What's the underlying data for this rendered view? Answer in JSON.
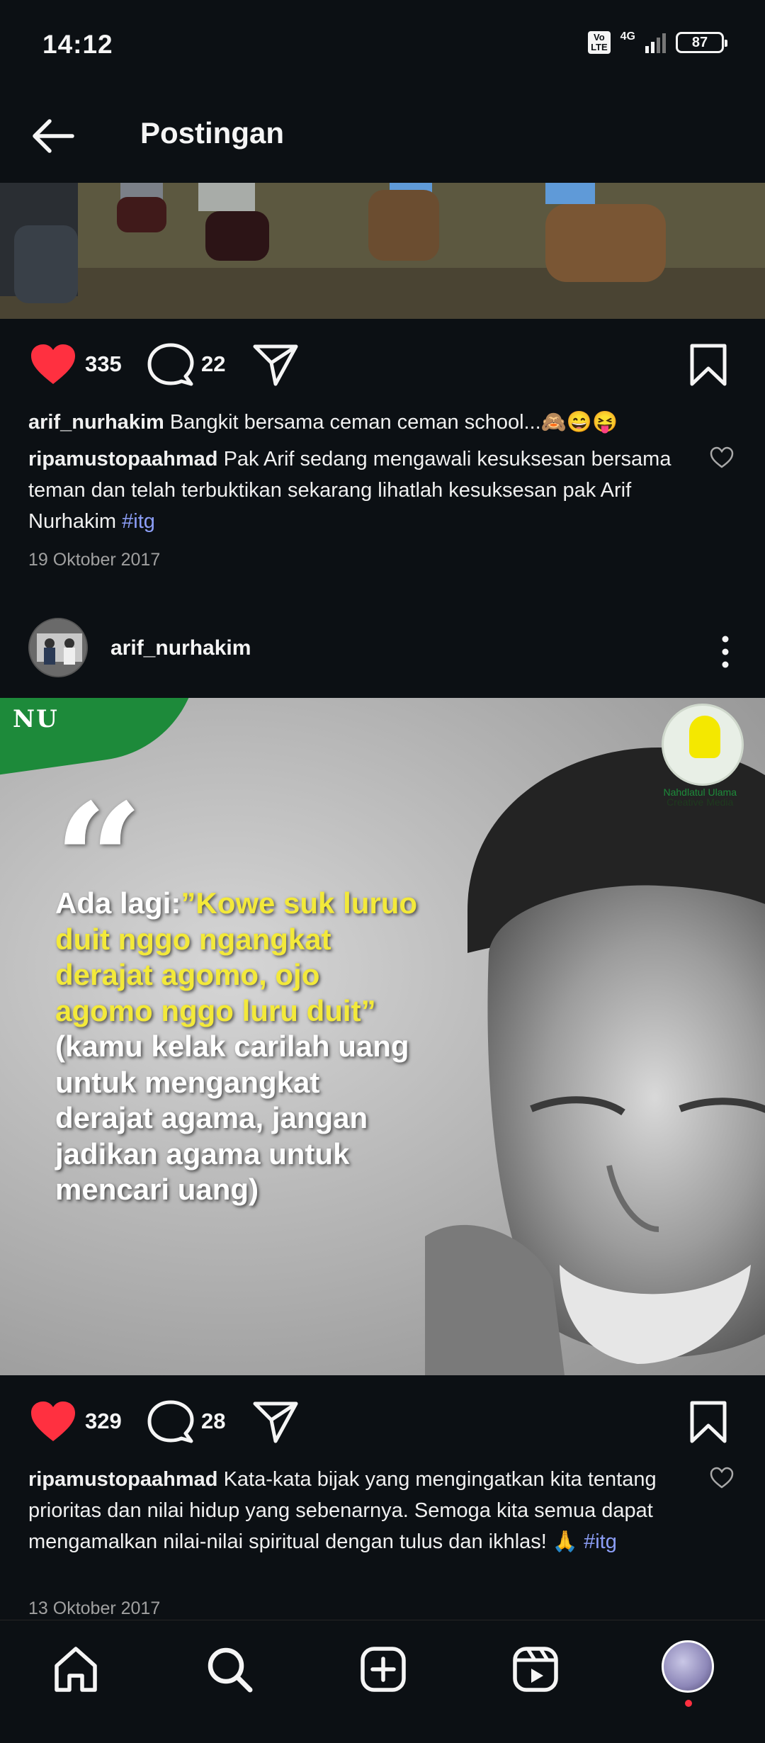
{
  "status_bar": {
    "time": "14:12",
    "volte": "Vo\nLTE",
    "network": "4G",
    "battery": "87"
  },
  "header": {
    "title": "Postingan"
  },
  "post1": {
    "likes": "335",
    "comments": "22",
    "caption_user": "arif_nurhakim",
    "caption_text": "Bangkit bersama ceman ceman school...🙈😄😝",
    "comment_user": "ripamustopaahmad",
    "comment_text": "Pak Arif sedang mengawali kesuksesan bersama teman dan telah terbuktikan sekarang lihatlah kesuksesan pak Arif Nurhakim ",
    "comment_tag": "#itg",
    "date": "19 Oktober 2017"
  },
  "post2": {
    "username": "arif_nurhakim",
    "image": {
      "logo_left": "NU",
      "logo_right_line1": "Nahdlatul Ulama",
      "logo_right_line2": "Creative Media",
      "quote_mark": "“",
      "quote_lead": "Ada lagi:",
      "quote_highlight": "”Kowe suk luruo duit nggo ngangkat derajat agomo, ojo agomo nggo luru duit”",
      "quote_translation": " (kamu kelak carilah uang untuk mengangkat derajat agama, jangan jadikan agama untuk mencari uang)"
    },
    "likes": "329",
    "comments": "28",
    "comment_user": "ripamustopaahmad",
    "comment_text": "Kata-kata bijak yang mengingatkan kita tentang prioritas dan nilai hidup yang sebenarnya. Semoga kita semua dapat mengamalkan nilai-nilai spiritual dengan tulus dan ikhlas! 🙏 ",
    "comment_tag": "#itg",
    "date": "13 Oktober 2017"
  },
  "bottom_nav": {
    "items": [
      "home-icon",
      "search-icon",
      "add-icon",
      "reels-icon",
      "profile-avatar"
    ]
  },
  "colors": {
    "background": "#0c1014",
    "like_red": "#ff3040",
    "hashtag": "#8c9ef7",
    "quote_yellow": "#f3e93a"
  }
}
